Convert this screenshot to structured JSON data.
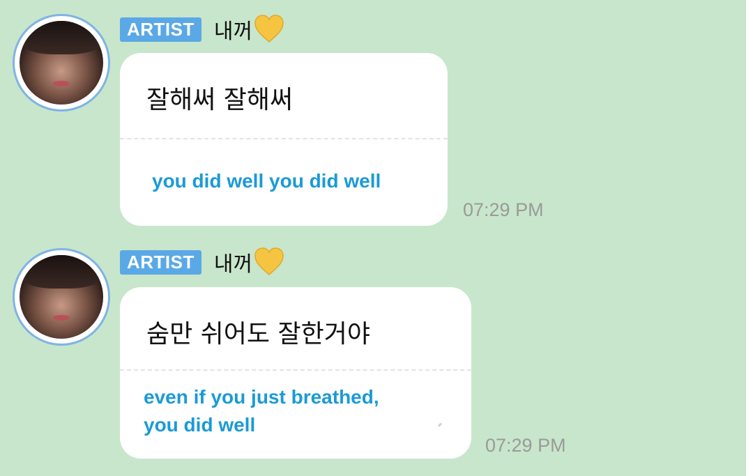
{
  "messages": [
    {
      "badge": "ARTIST",
      "name": "내꺼",
      "name_icon": "yellow-heart-icon",
      "original": "잘해써 잘해써",
      "translation_lines": [
        "you did well you did well"
      ],
      "time": "07:29 PM"
    },
    {
      "badge": "ARTIST",
      "name": "내꺼",
      "name_icon": "yellow-heart-icon",
      "original": "숨만 쉬어도 잘한거야",
      "translation_lines": [
        "even if you just breathed,",
        "you did well"
      ],
      "time": "07:29 PM"
    }
  ],
  "colors": {
    "background": "#c8e6cb",
    "badge": "#5aa9e6",
    "translation": "#1b9ad6",
    "heart": "#f5c542",
    "avatar_ring": "#7fb3e6"
  }
}
